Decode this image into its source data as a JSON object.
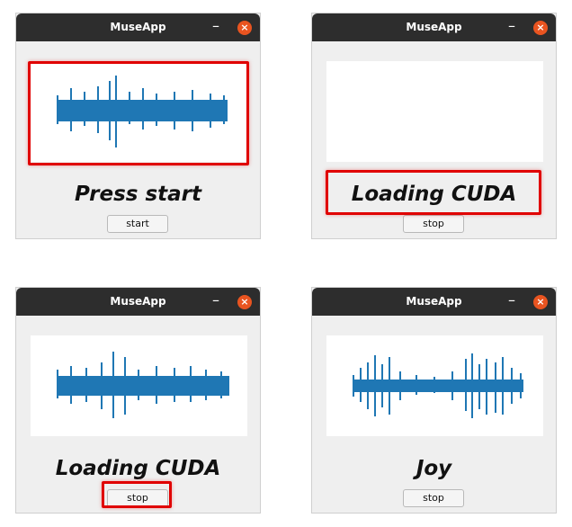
{
  "windows": [
    {
      "title": "MuseApp",
      "status": "Press start",
      "button": "start",
      "has_waveform": true
    },
    {
      "title": "MuseApp",
      "status": "Loading CUDA",
      "button": "stop",
      "has_waveform": false
    },
    {
      "title": "MuseApp",
      "status": "Loading CUDA",
      "button": "stop",
      "has_waveform": true
    },
    {
      "title": "MuseApp",
      "status": "Joy",
      "button": "stop",
      "has_waveform": true
    }
  ],
  "icons": {
    "minimize": "minimize-icon",
    "close": "close-icon"
  },
  "colors": {
    "waveform": "#1f77b4",
    "titlebar": "#2d2d2d",
    "close": "#e95420",
    "annotation": "#e00000"
  }
}
